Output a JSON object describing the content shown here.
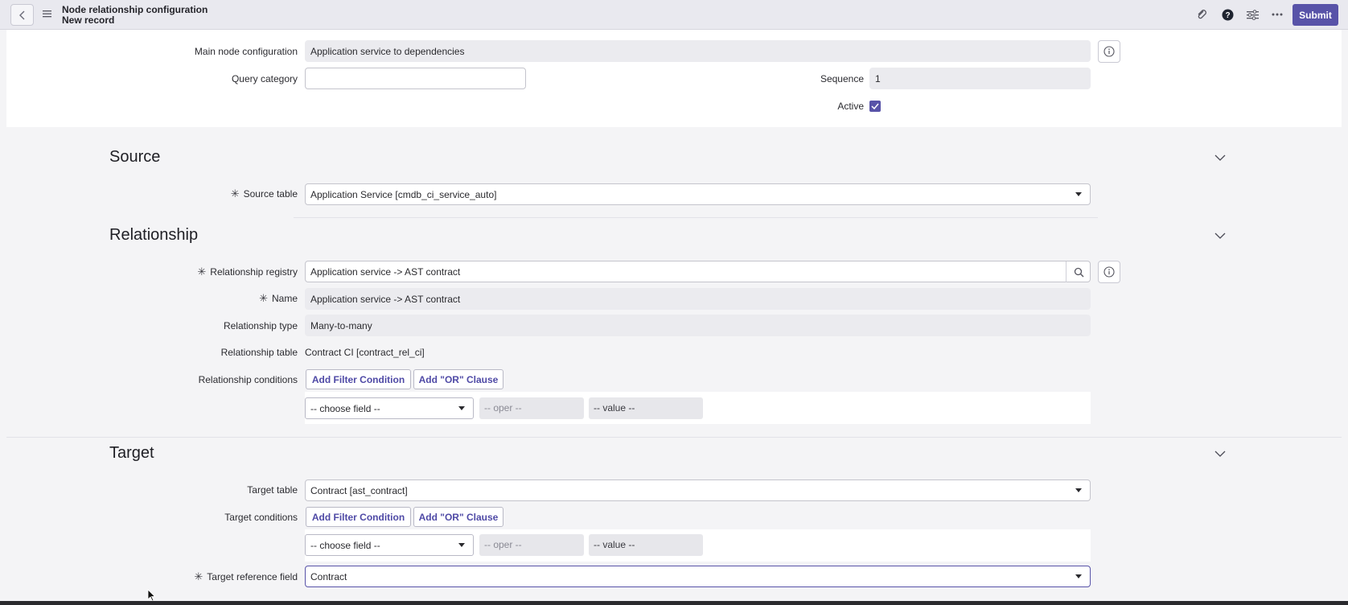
{
  "header": {
    "title": "Node relationship configuration",
    "subtitle": "New record",
    "submit_label": "Submit",
    "icons": [
      "back-icon",
      "menu-icon",
      "attachment-icon",
      "help-icon",
      "settings-icon",
      "more-icon"
    ]
  },
  "top": {
    "main_node_label": "Main node configuration",
    "main_node_value": "Application service to dependencies",
    "query_category_label": "Query category",
    "query_category_value": "",
    "sequence_label": "Sequence",
    "sequence_value": "1",
    "active_label": "Active",
    "active_checked": true
  },
  "source": {
    "title": "Source",
    "table_label": "Source table",
    "table_value": "Application Service [cmdb_ci_service_auto]"
  },
  "relationship": {
    "title": "Relationship",
    "registry_label": "Relationship registry",
    "registry_value": "Application service -> AST contract",
    "name_label": "Name",
    "name_value": "Application service -> AST contract",
    "type_label": "Relationship type",
    "type_value": "Many-to-many",
    "table_label": "Relationship table",
    "table_value": "Contract CI [contract_rel_ci]",
    "conditions_label": "Relationship conditions",
    "add_filter_label": "Add Filter Condition",
    "add_or_label": "Add \"OR\" Clause",
    "choose_field": "-- choose field --",
    "oper": "-- oper --",
    "value": "-- value --"
  },
  "target": {
    "title": "Target",
    "table_label": "Target table",
    "table_value": "Contract [ast_contract]",
    "conditions_label": "Target conditions",
    "add_filter_label": "Add Filter Condition",
    "add_or_label": "Add \"OR\" Clause",
    "choose_field": "-- choose field --",
    "oper": "-- oper --",
    "value": "-- value --",
    "reference_label": "Target reference field",
    "reference_value": "Contract"
  },
  "colors": {
    "accent": "#5853a8",
    "header_bg": "#e9e9ef",
    "page_bg": "#f4f4f6"
  }
}
